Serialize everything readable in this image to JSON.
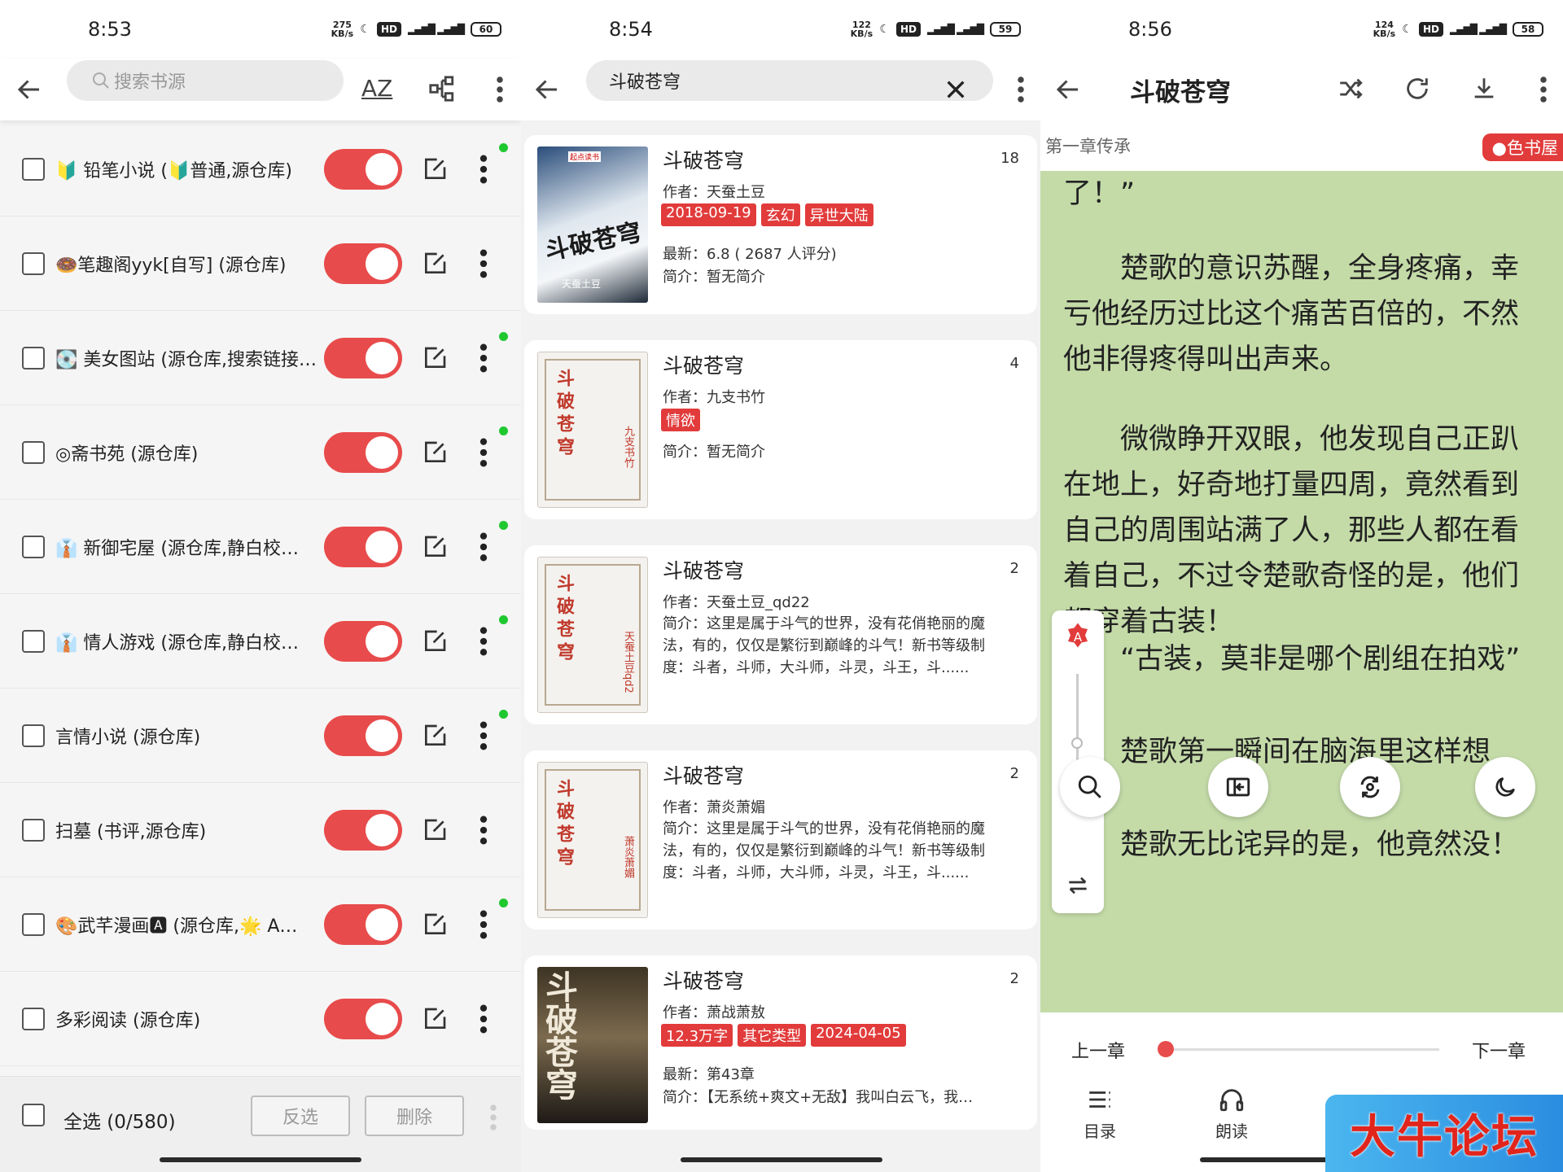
{
  "source_manager": {
    "status": {
      "time": "8:53",
      "speed": "275\nKB/s",
      "battery": "60"
    },
    "search_placeholder": "搜索书源",
    "sort_label": "AZ",
    "sources": [
      {
        "label": "🔰 铅笔小说 (🔰普通,源仓库)",
        "dot": true
      },
      {
        "label": "🍩笔趣阁yyk[自写] (源仓库)",
        "dot": false
      },
      {
        "label": "💽 美女图站 (源仓库,搜索链接…",
        "dot": true
      },
      {
        "label": "◎斋书苑 (源仓库)",
        "dot": true
      },
      {
        "label": "👔 新御宅屋 (源仓库,静白校…",
        "dot": true
      },
      {
        "label": "👔 情人游戏 (源仓库,静白校…",
        "dot": true
      },
      {
        "label": "言情小说 (源仓库)",
        "dot": true
      },
      {
        "label": "扫墓 (书评,源仓库)",
        "dot": false
      },
      {
        "label": "🎨武芊漫画🅰 (源仓库,🌟 A…",
        "dot": true
      },
      {
        "label": "多彩阅读 (源仓库)",
        "dot": false
      }
    ],
    "select_all": "全选 (0/580)",
    "invert_label": "反选",
    "delete_label": "删除"
  },
  "search_results": {
    "status": {
      "time": "8:54",
      "speed": "122\nKB/s",
      "battery": "59"
    },
    "query": "斗破苍穹",
    "results": [
      {
        "title": "斗破苍穹",
        "count": "18",
        "author": "作者：天蚕土豆",
        "tags": [
          "2018-09-19",
          "玄幻",
          "异世大陆"
        ],
        "latest": "最新：6.8 ( 2687 人评分)",
        "intro": "简介：暂无简介",
        "cover_title": "斗破苍穹",
        "cover_sub": "天蚕土豆",
        "cover_badge": "起点读书"
      },
      {
        "title": "斗破苍穹",
        "count": "4",
        "author": "作者：九支书竹",
        "tags": [
          "情欲"
        ],
        "intro": "简介：暂无简介",
        "cover_title": "斗破苍穹",
        "cover_author": "九支书竹"
      },
      {
        "title": "斗破苍穹",
        "count": "2",
        "author": "作者：天蚕土豆_qd22",
        "intro": "简介：这里是属于斗气的世界，没有花俏艳丽的魔法，有的，仅仅是繁衍到巅峰的斗气！新书等级制度：斗者，斗师，大斗师，斗灵，斗王，斗......",
        "cover_title": "斗破苍穹",
        "cover_author": "天蚕土豆qd2"
      },
      {
        "title": "斗破苍穹",
        "count": "2",
        "author": "作者：萧炎萧媚",
        "intro": "简介：这里是属于斗气的世界，没有花俏艳丽的魔法，有的，仅仅是繁衍到巅峰的斗气！新书等级制度：斗者，斗师，大斗师，斗灵，斗王，斗......",
        "cover_title": "斗破苍穹",
        "cover_author": "萧炎萧媚"
      },
      {
        "title": "斗破苍穹",
        "count": "2",
        "author": "作者：萧战萧敖",
        "tags": [
          "12.3万字",
          "其它类型",
          "2024-04-05"
        ],
        "latest": "最新：第43章",
        "intro": "简介：【无系统+爽文+无敌】我叫白云飞，我…",
        "cover_title": "斗破苍穹"
      }
    ]
  },
  "reader": {
    "status": {
      "time": "8:56",
      "speed": "124\nKB/s",
      "battery": "58"
    },
    "book_title": "斗破苍穹",
    "chapter": "第一章传承",
    "source_badge": "色书屋",
    "paragraphs": [
      "了！”",
      "　　楚歌的意识苏醒，全身疼痛，幸亏他经历过比这个痛苦百倍的，不然他非得疼得叫出声来。",
      "　　微微睁开双眼，他发现自己正趴在地上，好奇地打量四周，竟然看到自己的周围站满了人，那些人都在看着自己，不过令楚歌奇怪的是，他们都穿着古装！",
      "　　“古装，莫非是哪个剧组在拍戏”",
      "　　楚歌第一瞬间在脑海里这样想着。",
      "　　楚歌无比诧异的是，他竟然没！"
    ],
    "prev_chapter": "上一章",
    "next_chapter": "下一章",
    "progress": 0.0,
    "tab_toc": "目录",
    "tab_read_aloud": "朗读",
    "watermark": "大牛论坛"
  },
  "colors": {
    "accent": "#e84b4b",
    "online_dot": "#20c830",
    "reader_bg": "#c4dba8"
  }
}
